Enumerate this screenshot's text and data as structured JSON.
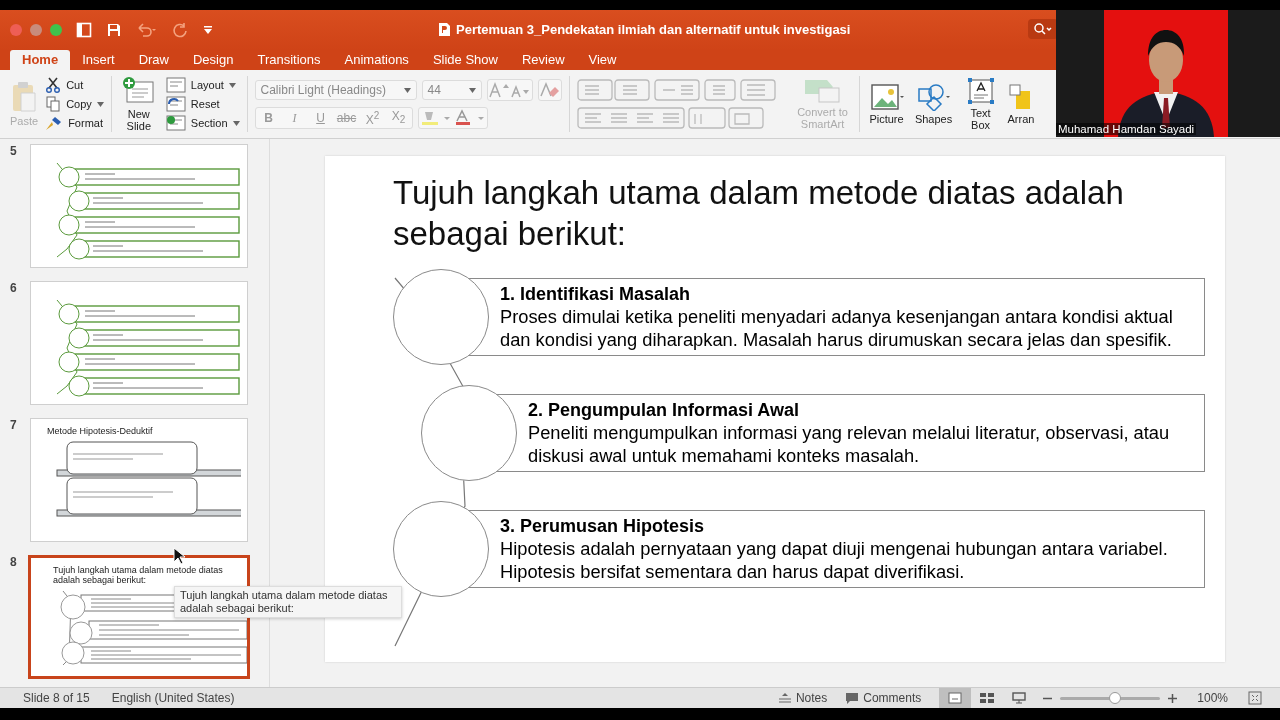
{
  "window": {
    "title": "Pertemuan 3_Pendekatan ilmiah dan alternatif untuk investigasi"
  },
  "ribbon_tabs": [
    {
      "label": "Home",
      "selected": true
    },
    {
      "label": "Insert",
      "selected": false
    },
    {
      "label": "Draw",
      "selected": false
    },
    {
      "label": "Design",
      "selected": false
    },
    {
      "label": "Transitions",
      "selected": false
    },
    {
      "label": "Animations",
      "selected": false
    },
    {
      "label": "Slide Show",
      "selected": false
    },
    {
      "label": "Review",
      "selected": false
    },
    {
      "label": "View",
      "selected": false
    }
  ],
  "ribbon": {
    "paste": {
      "label": "Paste",
      "disabled": true
    },
    "clipboard": [
      {
        "kind": "cut",
        "label": "Cut"
      },
      {
        "kind": "copy",
        "label": "Copy"
      },
      {
        "kind": "format",
        "label": "Format"
      }
    ],
    "new_slide": "New Slide",
    "slide_tools": [
      {
        "kind": "layout",
        "label": "Layout"
      },
      {
        "kind": "reset",
        "label": "Reset"
      },
      {
        "kind": "section",
        "label": "Section"
      }
    ],
    "font_name": "Calibri Light (Headings)",
    "font_size": "44",
    "format_buttons": [
      {
        "label": "B",
        "kind": "bold"
      },
      {
        "label": "I",
        "kind": "italic"
      },
      {
        "label": "U",
        "kind": "underline"
      },
      {
        "label": "abc",
        "kind": "strike"
      },
      {
        "label": "X$^{2}$",
        "kind": "superscript"
      },
      {
        "label": "X$_{2}$",
        "kind": "subscript"
      }
    ],
    "convert": {
      "label": "Convert to SmartArt",
      "disabled": true
    },
    "insert": [
      {
        "kind": "picture",
        "label": "Picture"
      },
      {
        "kind": "shapes",
        "label": "Shapes"
      },
      {
        "kind": "textbox",
        "label": "Text Box"
      },
      {
        "kind": "arrange",
        "label": "Arran"
      }
    ]
  },
  "webcam": {
    "name": "Muhamad Hamdan Sayadi"
  },
  "thumbnails": [
    {
      "number": "5",
      "kind": "list",
      "selected": false
    },
    {
      "number": "6",
      "kind": "list",
      "selected": false
    },
    {
      "number": "7",
      "kind": "blocks",
      "title": "Metode Hipotesis-Deduktif",
      "selected": false
    },
    {
      "number": "8",
      "kind": "steps",
      "title": "Tujuh langkah utama dalam metode diatas adalah sebagai berikut:",
      "selected": true
    }
  ],
  "tooltip": "Tujuh langkah utama dalam metode diatas adalah sebagai berikut:",
  "slide": {
    "title": "Tujuh langkah utama dalam metode diatas adalah sebagai berikut:",
    "steps": [
      {
        "heading": "1. Identifikasi Masalah",
        "body": "Proses dimulai ketika peneliti menyadari adanya kesenjangan antara kondisi aktual dan kondisi yang diharapkan. Masalah harus dirumuskan secara jelas dan spesifik."
      },
      {
        "heading": "2. Pengumpulan Informasi Awal",
        "body": "Peneliti mengumpulkan informasi yang relevan melalui literatur, observasi, atau diskusi awal untuk memahami konteks masalah."
      },
      {
        "heading": "3. Perumusan Hipotesis",
        "body": "Hipotesis adalah pernyataan yang dapat diuji mengenai hubungan antara variabel. Hipotesis bersifat sementara dan harus dapat diverifikasi."
      }
    ]
  },
  "status_bar": {
    "slide_info": "Slide 8 of 15",
    "language": "English (United States)",
    "notes": "Notes",
    "comments": "Comments",
    "views": [
      {
        "kind": "normal",
        "selected": true
      },
      {
        "kind": "sorter",
        "selected": false
      },
      {
        "kind": "reading",
        "selected": false
      }
    ],
    "zoom": {
      "level": 0.55,
      "reading": "100%"
    }
  }
}
